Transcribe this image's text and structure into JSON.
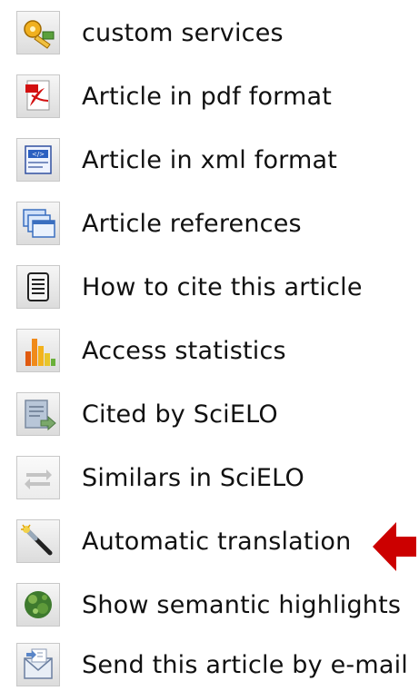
{
  "menu": {
    "items": [
      {
        "label": "custom services",
        "icon": "custom-services-icon"
      },
      {
        "label": "Article in pdf format",
        "icon": "pdf-icon"
      },
      {
        "label": "Article in xml format",
        "icon": "xml-icon"
      },
      {
        "label": "Article references",
        "icon": "references-icon"
      },
      {
        "label": "How to cite this article",
        "icon": "cite-icon"
      },
      {
        "label": "Access statistics",
        "icon": "statistics-icon"
      },
      {
        "label": "Cited by SciELO",
        "icon": "cited-by-icon"
      },
      {
        "label": "Similars in SciELO",
        "icon": "similars-icon"
      },
      {
        "label": "Automatic translation",
        "icon": "translation-icon"
      },
      {
        "label": "Show semantic highlights",
        "icon": "semantic-highlights-icon"
      },
      {
        "label": "Send this article by e-mail",
        "icon": "email-icon"
      }
    ]
  },
  "annotation": {
    "icon": "red-arrow-icon",
    "color": "#cc0000"
  }
}
